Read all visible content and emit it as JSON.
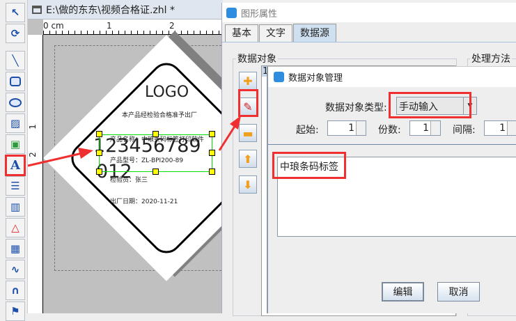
{
  "toolbar": {
    "items": [
      "select",
      "rotate",
      "line",
      "rounded-rect",
      "ellipse",
      "image",
      "image-insert",
      "text",
      "rich-text",
      "barcode",
      "shape",
      "qrcode",
      "curve",
      "arc",
      "flag"
    ],
    "text_glyph": "A"
  },
  "document": {
    "title": "E:\\做的东东\\视频合格证.zhl *",
    "ruler_unit": "0 cm",
    "ruler_top": [
      "1",
      "2"
    ],
    "ruler_left": [
      "1",
      "2"
    ]
  },
  "label": {
    "logo": "LOGO",
    "subtitle": "本产品经检验合格准予出厂",
    "product_name": "产品名称：中琅条码标签打印软件",
    "barcode_text_1": "123456789",
    "barcode_text_2": "012",
    "model": "产品型号：ZL-BPI200-89",
    "inspector": "检验员：张三",
    "date": "出厂日期：2020-11-21"
  },
  "props_dialog": {
    "title": "图形属性",
    "tabs": [
      "基本",
      "文字",
      "数据源"
    ],
    "active_tab": "数据源",
    "group_data": "数据对象",
    "group_process": "处理方法",
    "list_index": "1"
  },
  "dom_dialog": {
    "title": "数据对象管理",
    "type_label": "数据对象类型:",
    "type_value": "手动输入",
    "start_label": "起始:",
    "start_value": "1",
    "count_label": "份数:",
    "count_value": "1",
    "interval_label": "间隔:",
    "interval_value": "1",
    "content": "中琅条码标签",
    "edit_button": "编辑",
    "cancel_button": "取消"
  },
  "colors": {
    "highlight": "#f03030",
    "selection": "#00dd00",
    "handle": "#ffff00"
  }
}
